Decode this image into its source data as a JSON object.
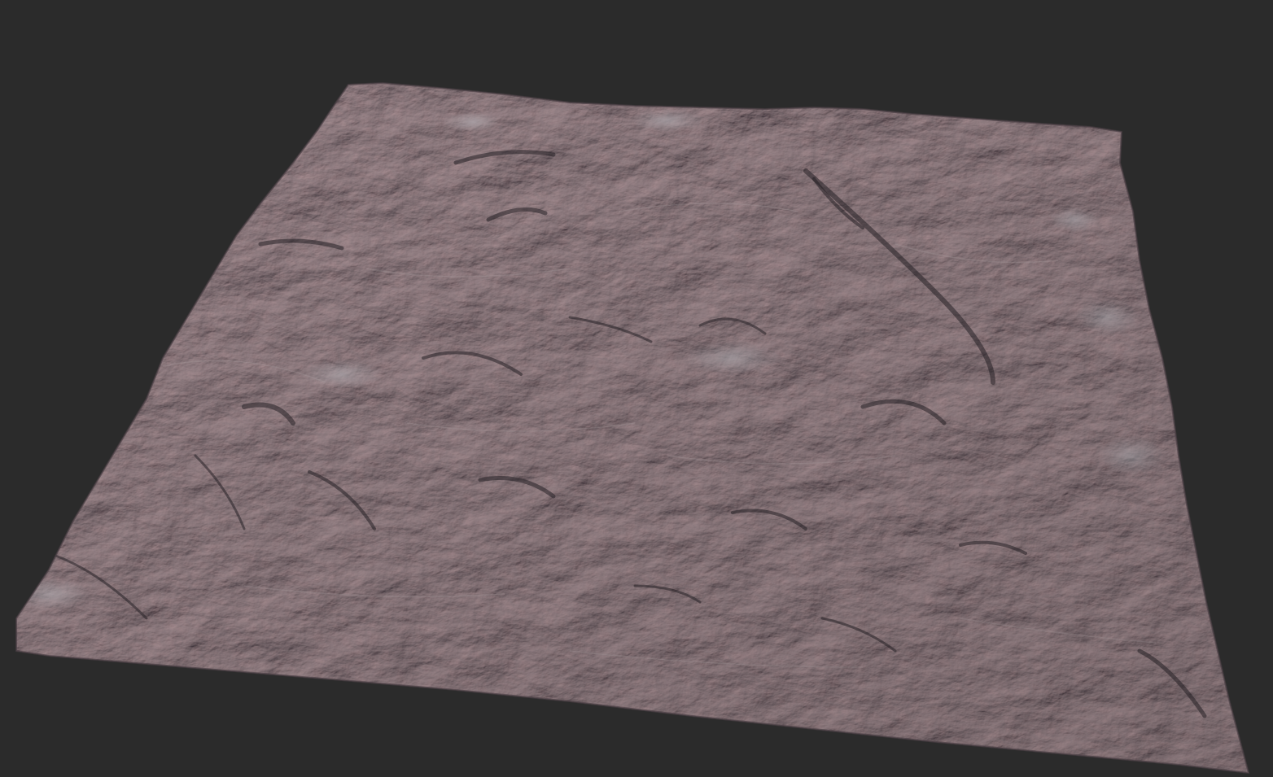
{
  "scene": {
    "background_color": "#2b2b2b",
    "subject": "terrain-heightmap-render",
    "terrain_colors": {
      "base": "#7d6868",
      "highlight": "#a89a9e",
      "shadow": "#2e2a2e",
      "snow_patch": "#b8b6bc"
    }
  }
}
